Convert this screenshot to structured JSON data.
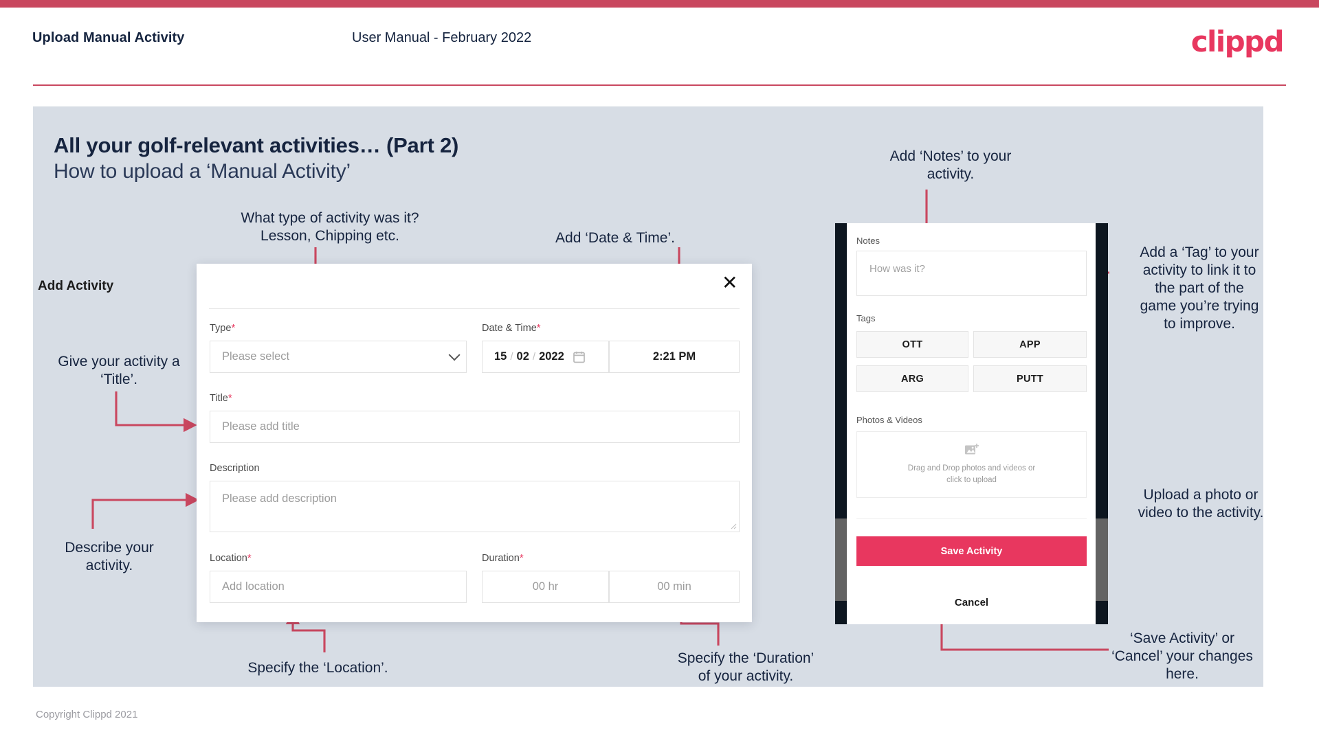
{
  "header": {
    "title": "Upload Manual Activity",
    "subtitle": "User Manual - February 2022",
    "logo": "clippd"
  },
  "slide": {
    "heading": "All your golf-relevant activities… (Part 2)",
    "subheading": "How to upload a ‘Manual Activity’",
    "copyright": "Copyright Clippd 2021"
  },
  "colors": {
    "brand_pink": "#e8375f",
    "top_bar": "#c9475f",
    "canvas": "#d7dde5",
    "ink": "#16243f"
  },
  "annotations": {
    "type": "What type of activity was it?\nLesson, Chipping etc.",
    "datetime": "Add ‘Date & Time’.",
    "title": "Give your activity a\n‘Title’.",
    "description": "Describe your\nactivity.",
    "location": "Specify the ‘Location’.",
    "duration": "Specify the ‘Duration’\nof your activity.",
    "notes": "Add ‘Notes’ to your\nactivity.",
    "tags": "Add a ‘Tag’ to your\nactivity to link it to\nthe part of the\ngame you’re trying\nto improve.",
    "photos": "Upload a photo or\nvideo to the activity.",
    "save": "‘Save Activity’ or\n‘Cancel’ your changes\nhere."
  },
  "dialog": {
    "title": "Add Activity",
    "close_icon": "close-icon",
    "fields": {
      "type": {
        "label": "Type",
        "required": "*",
        "placeholder": "Please select"
      },
      "datetime": {
        "label": "Date & Time",
        "required": "*",
        "day": "15",
        "sep1": "/",
        "month": "02",
        "sep2": "/",
        "year": "2022",
        "time": "2:21 PM"
      },
      "title": {
        "label": "Title",
        "required": "*",
        "placeholder": "Please add title"
      },
      "description": {
        "label": "Description",
        "required": "",
        "placeholder": "Please add description"
      },
      "location": {
        "label": "Location",
        "required": "*",
        "placeholder": "Add location"
      },
      "duration": {
        "label": "Duration",
        "required": "*",
        "hours": "00 hr",
        "minutes": "00 min"
      }
    }
  },
  "mobile": {
    "notes": {
      "label": "Notes",
      "placeholder": "How was it?"
    },
    "tags": {
      "label": "Tags",
      "items": [
        "OTT",
        "APP",
        "ARG",
        "PUTT"
      ]
    },
    "photos": {
      "label": "Photos & Videos",
      "dropzone": "Drag and Drop photos and videos or\nclick to upload",
      "icon": "add-image-icon"
    },
    "save_label": "Save Activity",
    "cancel_label": "Cancel"
  }
}
